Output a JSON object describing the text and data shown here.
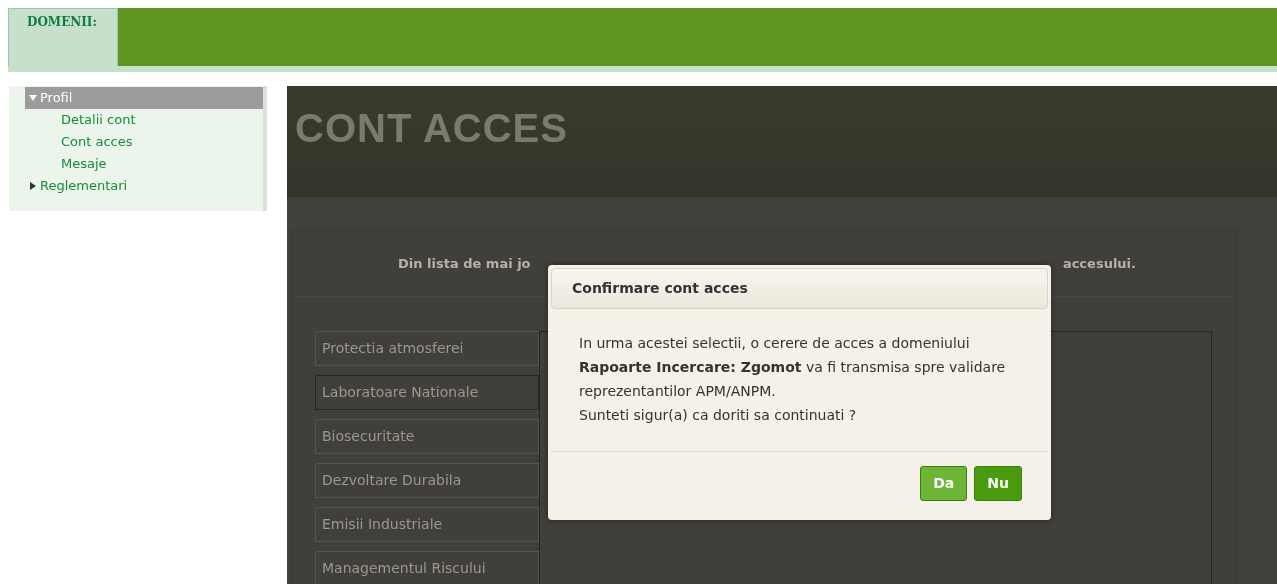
{
  "top_bar": {
    "tab": "DOMENII:"
  },
  "sidebar": {
    "items": [
      {
        "label": "Profil",
        "expanded": true,
        "selected": true,
        "children": [
          {
            "label": "Detalii cont"
          },
          {
            "label": "Cont acces"
          },
          {
            "label": "Mesaje"
          }
        ]
      },
      {
        "label": "Reglementari",
        "expanded": false,
        "selected": false
      }
    ]
  },
  "page": {
    "title": "CONT ACCES",
    "intro_left": "Din lista de mai jo",
    "intro_right": "accesului.",
    "domains": [
      {
        "label": "Protectia atmosferei",
        "selected": false
      },
      {
        "label": "Laboratoare Nationale",
        "selected": true
      },
      {
        "label": "Biosecuritate",
        "selected": false
      },
      {
        "label": "Dezvoltare Durabila",
        "selected": false
      },
      {
        "label": "Emisii Industriale",
        "selected": false
      },
      {
        "label": "Managementul Riscului",
        "selected": false
      }
    ]
  },
  "dialog": {
    "title": "Confirmare cont acces",
    "message": [
      "In urma acestei selectii, o cerere de acces a domeniului",
      "**Rapoarte Incercare: Zgomot** va fi transmisa spre validare",
      "reprezentantilor APM/ANPM.",
      "Sunteti sigur(a) ca doriti sa continuati ?"
    ],
    "buttons": [
      {
        "label": "Da",
        "kind": "light"
      },
      {
        "label": "Nu",
        "kind": "dark"
      }
    ]
  }
}
